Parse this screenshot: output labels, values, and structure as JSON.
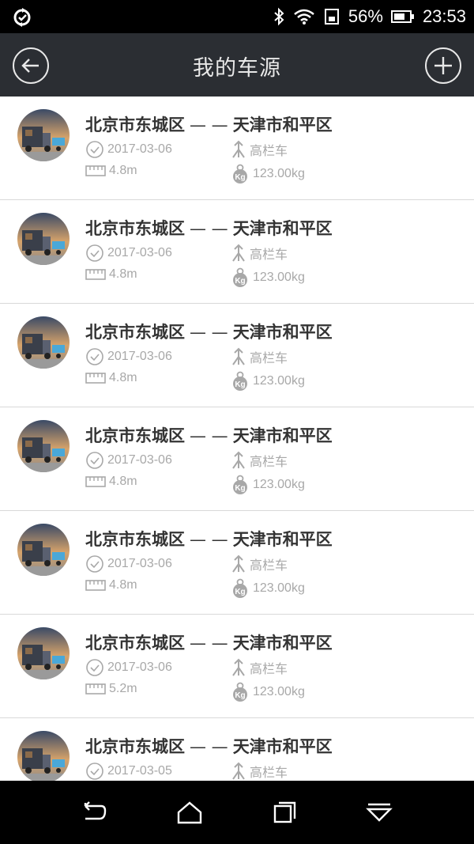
{
  "status_bar": {
    "battery_percent": "56%",
    "time": "23:53",
    "icons": [
      "sync-icon",
      "bluetooth-icon",
      "wifi-icon",
      "sim-icon",
      "battery-icon"
    ]
  },
  "header": {
    "title": "我的车源",
    "back_icon": "arrow-left-icon",
    "add_icon": "plus-icon"
  },
  "list": {
    "dash": "— —",
    "items": [
      {
        "from": "北京市东城区",
        "to": "天津市和平区",
        "date": "2017-03-06",
        "truck_type": "高栏车",
        "length": "4.8m",
        "weight": "123.00kg"
      },
      {
        "from": "北京市东城区",
        "to": "天津市和平区",
        "date": "2017-03-06",
        "truck_type": "高栏车",
        "length": "4.8m",
        "weight": "123.00kg"
      },
      {
        "from": "北京市东城区",
        "to": "天津市和平区",
        "date": "2017-03-06",
        "truck_type": "高栏车",
        "length": "4.8m",
        "weight": "123.00kg"
      },
      {
        "from": "北京市东城区",
        "to": "天津市和平区",
        "date": "2017-03-06",
        "truck_type": "高栏车",
        "length": "4.8m",
        "weight": "123.00kg"
      },
      {
        "from": "北京市东城区",
        "to": "天津市和平区",
        "date": "2017-03-06",
        "truck_type": "高栏车",
        "length": "4.8m",
        "weight": "123.00kg"
      },
      {
        "from": "北京市东城区",
        "to": "天津市和平区",
        "date": "2017-03-06",
        "truck_type": "高栏车",
        "length": "5.2m",
        "weight": "123.00kg"
      },
      {
        "from": "北京市东城区",
        "to": "天津市和平区",
        "date": "2017-03-05",
        "truck_type": "高栏车",
        "length": "",
        "weight": ""
      }
    ]
  },
  "nav_bar": {
    "icons": [
      "back-nav-icon",
      "home-icon",
      "recent-apps-icon",
      "dropdown-icon"
    ]
  },
  "colors": {
    "header_bg": "#2b2e33",
    "header_text": "#e8e8e8",
    "route_text": "#333333",
    "meta_text": "#a8a8a8",
    "divider": "#d9d9d9"
  }
}
